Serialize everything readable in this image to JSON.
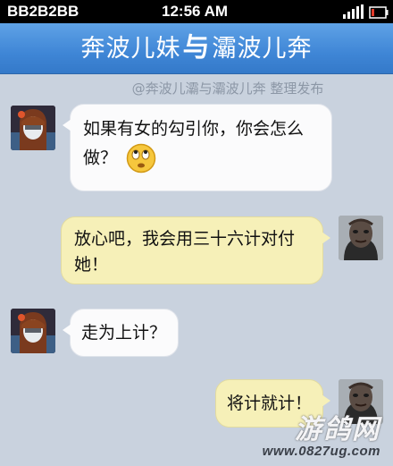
{
  "status_bar": {
    "carrier": "BB2B2BB",
    "time": "12:56 AM"
  },
  "header": {
    "title_left": "奔波儿妹",
    "title_sep": "与",
    "title_right": "灞波儿奔"
  },
  "credit": "@奔波儿灞与灞波儿奔 整理发布",
  "messages": [
    {
      "sender": "girl",
      "line1": "如果有女的勾引你，你会怎么",
      "line2": "做？",
      "emoji": "rolling-eyes-emoji"
    },
    {
      "sender": "zombie",
      "line1": "放心吧，我会用三十六计对付",
      "line2": "她！"
    },
    {
      "sender": "girl",
      "line1": "走为上计？"
    },
    {
      "sender": "zombie",
      "line1": "将计就计！"
    }
  ],
  "watermark": {
    "logo": "游鸽网",
    "url": "www.0827ug.com"
  },
  "colors": {
    "title_bar": "#3f86d6",
    "background": "#c9d2de",
    "incoming_bubble": "#fbfbfc",
    "outgoing_bubble": "#f6f0b8"
  }
}
